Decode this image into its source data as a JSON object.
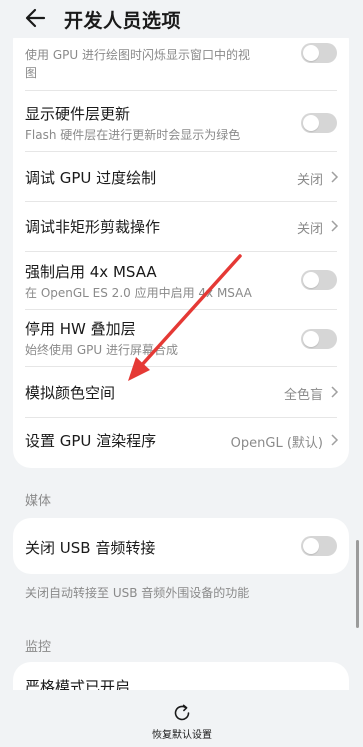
{
  "header": {
    "title": "开发人员选项"
  },
  "card1": {
    "gpu_flash_subtitle_1": "使用 GPU 进行绘图时闪烁显示窗口中的视",
    "gpu_flash_subtitle_2": "图",
    "hw_layers_title": "显示硬件层更新",
    "hw_layers_subtitle": "Flash 硬件层在进行更新时会显示为绿色",
    "gpu_overdraw_title": "调试 GPU 过度绘制",
    "gpu_overdraw_value": "关闭",
    "non_rect_clip_title": "调试非矩形剪裁操作",
    "non_rect_clip_value": "关闭",
    "msaa_title": "强制启用 4x MSAA",
    "msaa_subtitle": "在 OpenGL ES 2.0 应用中启用 4x MSAA",
    "hw_overlay_title": "停用 HW 叠加层",
    "hw_overlay_subtitle": "始终使用 GPU 进行屏幕合成",
    "color_space_title": "模拟颜色空间",
    "color_space_value": "全色盲",
    "gpu_renderer_title": "设置 GPU 渲染程序",
    "gpu_renderer_value": "OpenGL (默认)"
  },
  "media": {
    "section_label": "媒体",
    "usb_audio_title": "关闭 USB 音频转接",
    "usb_audio_note": "关闭自动转接至 USB 音频外围设备的功能"
  },
  "monitor": {
    "section_label": "监控",
    "strict_mode_title": "严格模式已开启"
  },
  "footer": {
    "reset_label": "恢复默认设置"
  },
  "colors": {
    "annotation_arrow": "#e53935",
    "toggle_off": "#d6d6d6",
    "background": "#f1f3f5"
  },
  "icons": {
    "back": "back-arrow-icon",
    "reset": "refresh-icon",
    "chevron": "chevron-right-icon"
  }
}
